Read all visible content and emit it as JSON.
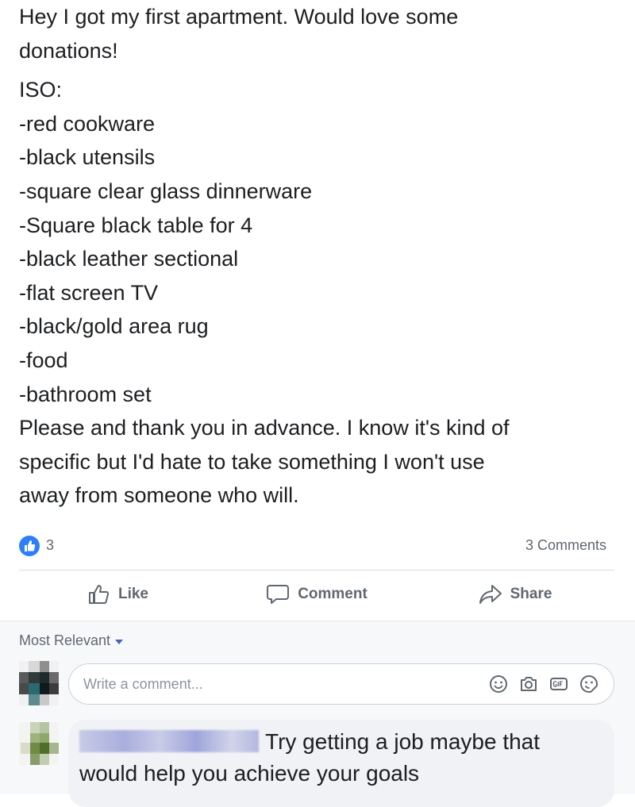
{
  "post": {
    "intro": [
      "Hey I got my first apartment. Would love some",
      "donations!"
    ],
    "iso_heading": "ISO:",
    "iso_items": [
      "-red cookware",
      "-black utensils",
      "-square clear glass dinnerware",
      "-Square black table for 4",
      "-black leather sectional",
      "-flat screen TV",
      "-black/gold area rug",
      "-food",
      "-bathroom set"
    ],
    "outro": [
      "Please and thank you in advance. I know it's kind of",
      "specific but I'd hate to take something I won't use",
      "away from someone who will."
    ]
  },
  "reactions": {
    "like_count": "3",
    "comments": "3 Comments"
  },
  "actions": {
    "like": "Like",
    "comment": "Comment",
    "share": "Share"
  },
  "comments_section": {
    "sort_label": "Most Relevant",
    "write_placeholder": "Write a comment...",
    "first_comment": "Try getting a job maybe that would help you achieve your goals"
  },
  "icons": {
    "like_badge": "thumbs-up-icon",
    "write_icons": [
      "smiley-icon",
      "camera-icon",
      "gif-icon",
      "sticker-icon"
    ]
  },
  "colors": {
    "accent": "#2d7ff9",
    "secondary_text": "#606770",
    "section_bg": "#f7f8fa"
  }
}
